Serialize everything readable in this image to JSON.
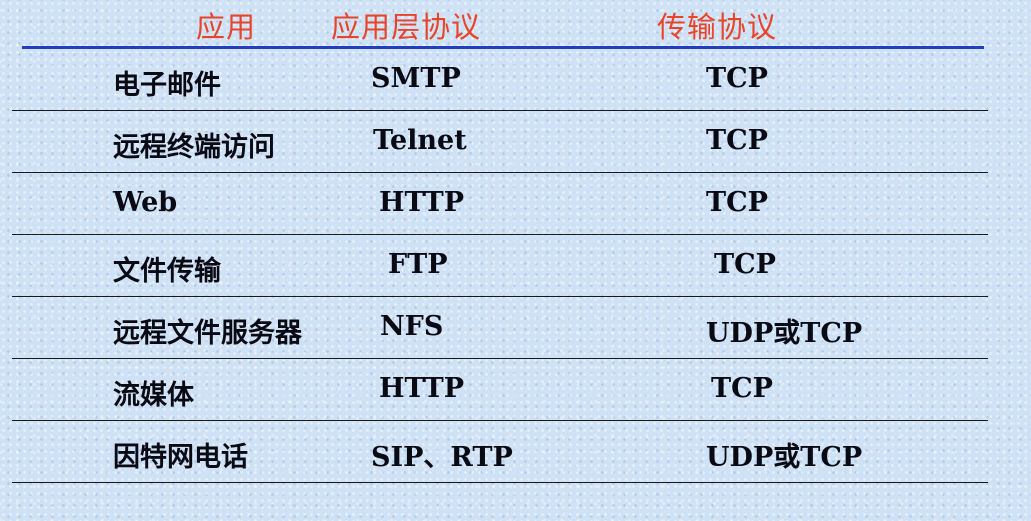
{
  "header": {
    "col1": "应用",
    "col2": "应用层协议",
    "col3": "传输协议"
  },
  "rows": [
    {
      "app": "电子邮件",
      "app_protocol": "SMTP",
      "transport": "TCP"
    },
    {
      "app": "远程终端访问",
      "app_protocol": "Telnet",
      "transport": "TCP"
    },
    {
      "app": "Web",
      "app_protocol": "HTTP",
      "transport": "TCP"
    },
    {
      "app": "文件传输",
      "app_protocol": "FTP",
      "transport": "TCP"
    },
    {
      "app": "远程文件服务器",
      "app_protocol": "NFS",
      "transport": "UDP或TCP"
    },
    {
      "app": "流媒体",
      "app_protocol": "HTTP",
      "transport": "TCP"
    },
    {
      "app": "因特网电话",
      "app_protocol": "SIP、RTP",
      "transport": "UDP或TCP"
    }
  ],
  "colors": {
    "header_text": "#e8442a",
    "header_rule": "#1f3fbf",
    "body_text": "#0a0a14"
  }
}
